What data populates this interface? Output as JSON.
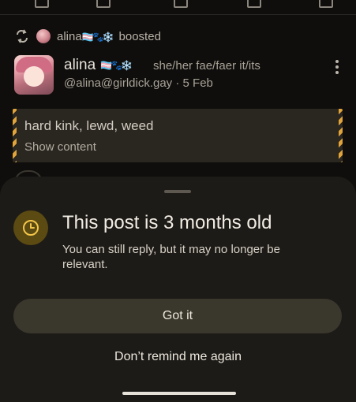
{
  "boost": {
    "user": "alina",
    "emoji": "🏳️‍⚧️🐾❄️",
    "label": "boosted"
  },
  "post": {
    "author_name": "alina",
    "author_emoji": "🏳️‍⚧️🐾❄️",
    "pronouns": "she/her fae/faer it/its",
    "handle": "@alina@girldick.gay",
    "separator": "·",
    "date": "5 Feb",
    "content_warning": "hard kink, lewd, weed",
    "show_content_label": "Show content"
  },
  "sheet": {
    "title": "This post is 3 months old",
    "body": "You can still reply, but it may no longer be relevant.",
    "primary_button": "Got it",
    "secondary_button": "Don’t remind me again",
    "clock_icon": "clock-icon"
  },
  "colors": {
    "background": "#0f0e0c",
    "sheet": "#1d1b17",
    "button": "#3a372d",
    "badge": "#5b4a12",
    "accent": "#e0a43a"
  }
}
